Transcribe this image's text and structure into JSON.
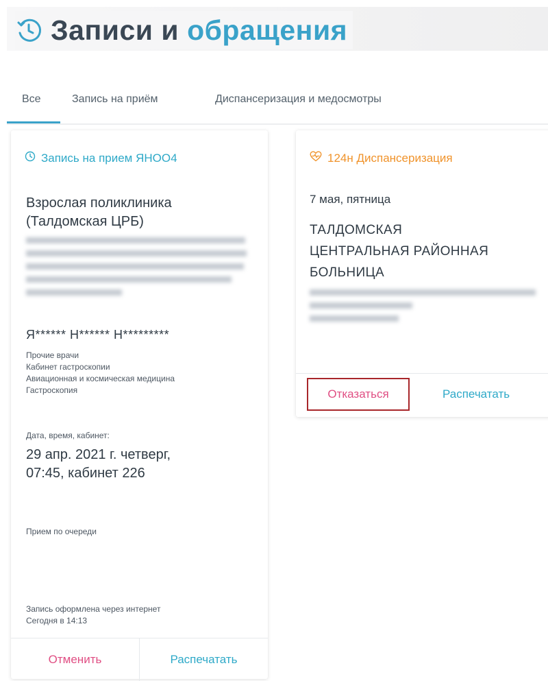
{
  "header": {
    "title_part1": "Записи и",
    "title_part2": "обращения",
    "icon": "history-icon",
    "title_color": "#3a4754",
    "accent_color": "#3aa2c9"
  },
  "tabs": [
    {
      "label": "Все",
      "active": true
    },
    {
      "label": "Запись на приём",
      "active": false
    },
    {
      "label": "Диспансеризация и медосмотры",
      "active": false
    }
  ],
  "appointment_card": {
    "icon": "clock-icon",
    "type_label": "Запись на прием ЯНОО4",
    "clinic_line1": "Взрослая поликлиника",
    "clinic_line2": "(Талдомская ЦРБ)",
    "patient_name": "Я****** Н****** Н*********",
    "details": [
      "Прочие врачи",
      "Кабинет гастроскопии",
      "Авиационная и космическая медицина",
      "Гастроскопия"
    ],
    "datetime_label": "Дата, время, кабинет:",
    "datetime_line1": "29 апр. 2021 г. четверг,",
    "datetime_line2": "07:45, кабинет 226",
    "queue_note": "Прием по очереди",
    "created_line1": "Запись оформлена через интернет",
    "created_line2": "Сегодня в 14:13",
    "cancel_label": "Отменить",
    "print_label": "Распечатать"
  },
  "dispensary_card": {
    "icon": "heart-pulse-icon",
    "type_label": "124н Диспансеризация",
    "date": "7 мая, пятница",
    "hospital_line1": "ТАЛДОМСКАЯ",
    "hospital_line2": "ЦЕНТРАЛЬНАЯ РАЙОННАЯ",
    "hospital_line3": "БОЛЬНИЦА",
    "refuse_label": "Отказаться",
    "print_label": "Распечатать"
  },
  "colors": {
    "teal": "#2ea9c8",
    "orange": "#f0932b",
    "pink": "#e04e83",
    "highlight_border": "#a8262a"
  }
}
